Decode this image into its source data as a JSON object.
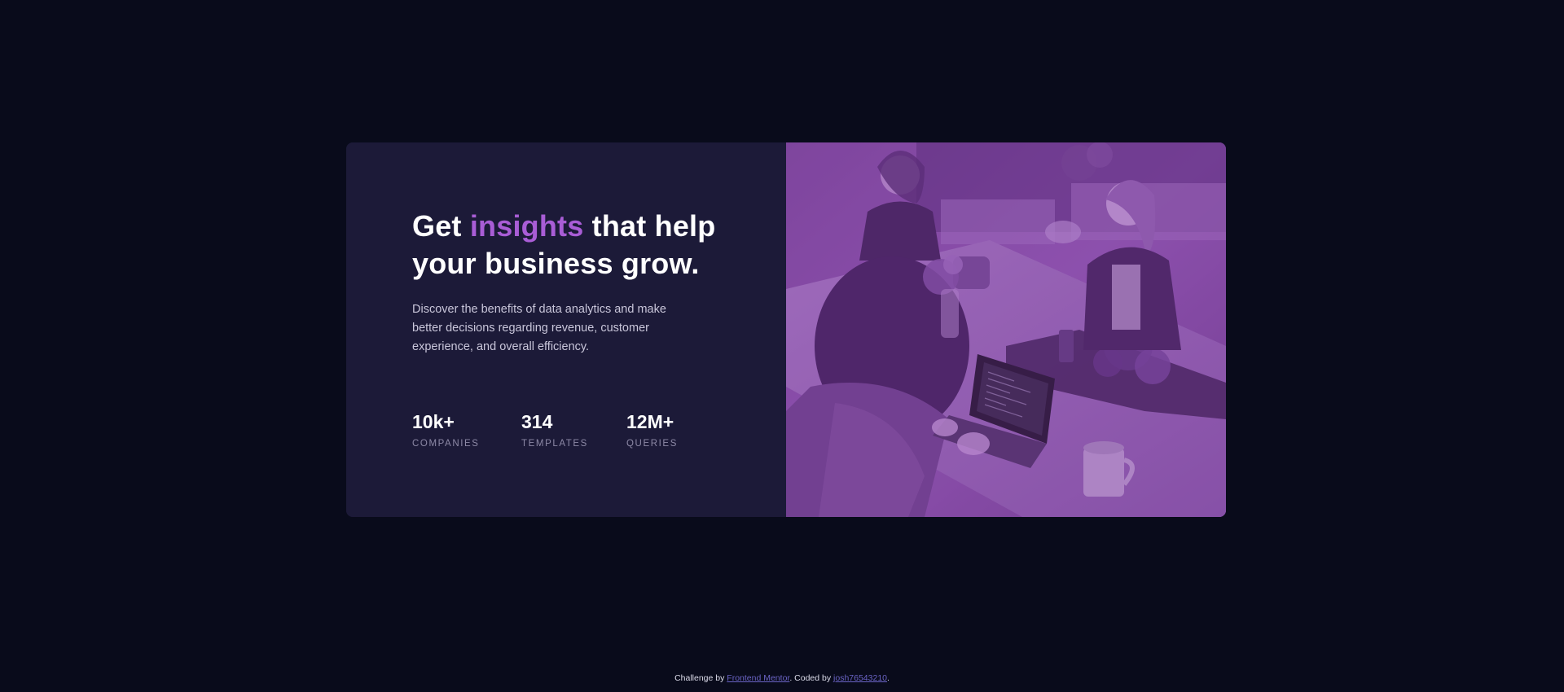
{
  "hero": {
    "title_start": "Get ",
    "title_accent": "insights",
    "title_end": " that help your business grow.",
    "description": "Discover the benefits of data analytics and make better decisions regarding revenue, customer experience, and overall efficiency."
  },
  "stats": [
    {
      "value": "10k+",
      "label": "COMPANIES"
    },
    {
      "value": "314",
      "label": "TEMPLATES"
    },
    {
      "value": "12M+",
      "label": "QUERIES"
    }
  ],
  "image": {
    "icon": "team-photo-image"
  },
  "attribution": {
    "prefix": "Challenge by ",
    "challenge_link": "Frontend Mentor",
    "middle": ". Coded by ",
    "author_link": "josh76543210",
    "suffix": "."
  },
  "colors": {
    "page_background": "#090b1b",
    "card_background": "#1c1a38",
    "accent": "#a95dd6",
    "image_overlay": "#8a4dab",
    "stat_label": "#8d89a6",
    "link": "#6a63c4"
  }
}
